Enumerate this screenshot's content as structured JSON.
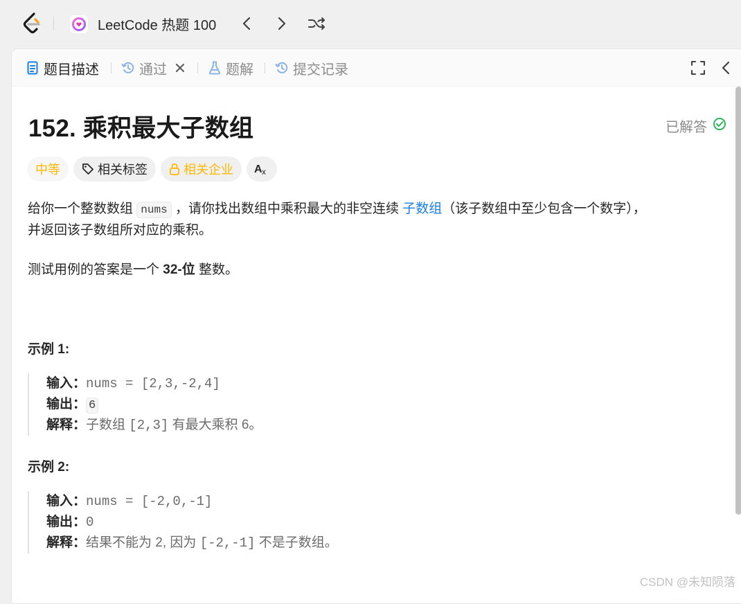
{
  "nav": {
    "problem_list_title": "LeetCode 热题 100"
  },
  "tabs": [
    {
      "label": "题目描述",
      "icon": "document-icon",
      "active": true
    },
    {
      "label": "通过",
      "icon": "history-icon"
    },
    {
      "label": "题解",
      "icon": "flask-icon"
    },
    {
      "label": "提交记录",
      "icon": "history-icon"
    }
  ],
  "problem": {
    "title": "152. 乘积最大子数组",
    "status": "已解答",
    "difficulty": "中等",
    "tags": [
      "相关标签",
      "相关企业"
    ],
    "description": {
      "p1_a": "给你一个整数数组 ",
      "p1_code": "nums",
      "p1_b": " ，请你找出数组中乘积最大的非空连续 ",
      "p1_link": "子数组",
      "p1_c": "（该子数组中至少包含一个数字），",
      "p1_line2": "并返回该子数组所对应的乘积。",
      "p2_a": "测试用例的答案是一个 ",
      "p2_bold": "32-位",
      "p2_b": " 整数。"
    },
    "examples": [
      {
        "heading": "示例 1:",
        "input_label": "输入：",
        "input": "nums = [2,3,-2,4]",
        "output_label": "输出：",
        "output": "6",
        "explain_label": "解释：",
        "explain_a": "子数组 ",
        "explain_code": "[2,3]",
        "explain_b": " 有最大乘积 6。"
      },
      {
        "heading": "示例 2:",
        "input_label": "输入：",
        "input": "nums = [-2,0,-1]",
        "output_label": "输出：",
        "output": "0",
        "explain_label": "解释：",
        "explain_a": "结果不能为 2, 因为 ",
        "explain_code": "[-2,-1]",
        "explain_b": " 不是子数组。"
      }
    ]
  },
  "watermark": "CSDN @未知陨落",
  "colors": {
    "accent": "#1a7de8",
    "difficulty_medium": "#ffb800",
    "solved_green": "#2db55d"
  }
}
